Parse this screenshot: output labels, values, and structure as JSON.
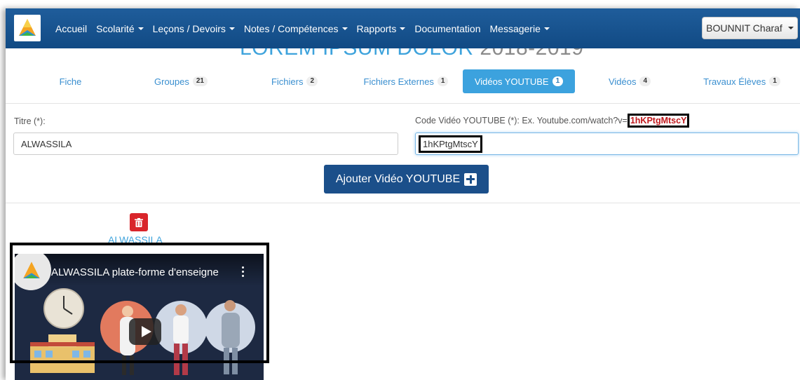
{
  "navbar": {
    "items": [
      {
        "label": "Accueil",
        "dropdown": false
      },
      {
        "label": "Scolarité",
        "dropdown": true
      },
      {
        "label": "Leçons / Devoirs",
        "dropdown": true
      },
      {
        "label": "Notes / Compétences",
        "dropdown": true
      },
      {
        "label": "Rapports",
        "dropdown": true
      },
      {
        "label": "Documentation",
        "dropdown": false
      },
      {
        "label": "Messagerie",
        "dropdown": true
      }
    ],
    "user": "BOUNNIT Charaf",
    "colors": {
      "bar": "#1a548f",
      "text": "#ffffff"
    }
  },
  "page": {
    "title": "LOREM IPSUM DOLOR",
    "year": "2018-2019"
  },
  "tabs": [
    {
      "label": "Fiche",
      "count": null,
      "active": false
    },
    {
      "label": "Groupes",
      "count": "21",
      "active": false
    },
    {
      "label": "Fichiers",
      "count": "2",
      "active": false
    },
    {
      "label": "Fichiers Externes",
      "count": "1",
      "active": false
    },
    {
      "label": "Vidéos YOUTUBE",
      "count": "1",
      "active": true
    },
    {
      "label": "Vidéos",
      "count": "4",
      "active": false
    },
    {
      "label": "Travaux Élèves",
      "count": "1",
      "active": false
    }
  ],
  "form": {
    "title_label": "Titre (*):",
    "title_value": "ALWASSILA",
    "code_label": "Code Vidéo YOUTUBE (*): Ex. Youtube.com/watch?v=",
    "code_example": "1hKPtgMtscY",
    "code_value": "1hKPtgMtscY",
    "add_button": "Ajouter Vidéo YOUTUBE"
  },
  "video": {
    "title": "ALWASSILA",
    "player_title": "ALWASSILA plate-forme d'enseigne",
    "icons": {
      "delete": "trash-icon",
      "play": "play-icon",
      "menu": "more-vert-icon"
    }
  },
  "colors": {
    "accent": "#3ca2de",
    "danger": "#d9252b",
    "primary": "#1b4f8a"
  }
}
